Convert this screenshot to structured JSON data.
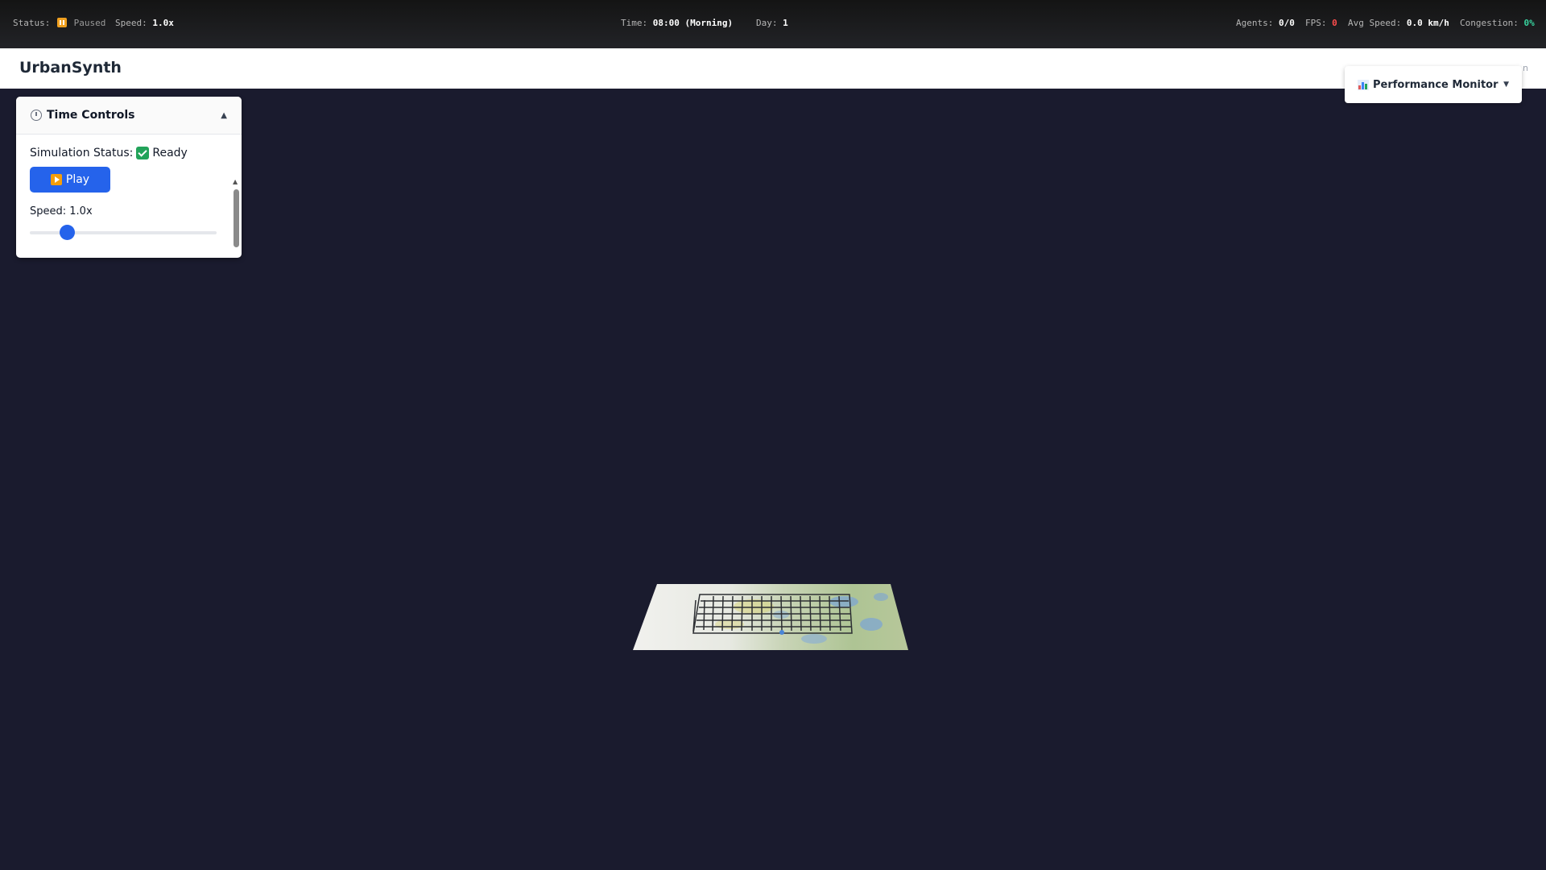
{
  "status_bar": {
    "status_label": "Status:",
    "status_value": "Paused",
    "speed_label": "Speed:",
    "speed_value": "1.0x",
    "time_label": "Time:",
    "time_value": "08:00 (Morning)",
    "day_label": "Day:",
    "day_value": "1",
    "agents_label": "Agents:",
    "agents_value": "0/0",
    "fps_label": "FPS:",
    "fps_value": "0",
    "avg_speed_label": "Avg Speed:",
    "avg_speed_value": "0.0 km/h",
    "congestion_label": "Congestion:",
    "congestion_value": "0%"
  },
  "header": {
    "title": "UrbanSynth",
    "trailing_text": "n"
  },
  "time_controls": {
    "title": "Time Controls",
    "collapse_symbol": "▲",
    "status_label": "Simulation Status:",
    "status_value": "Ready",
    "play_label": "Play",
    "speed_label": "Speed: 1.0x",
    "speed_slider_fraction": 0.2,
    "scroll_up": "▲",
    "scroll_down": "▼"
  },
  "performance_monitor": {
    "label": "Performance Monitor",
    "caret": "▼"
  },
  "icons": {
    "status": "pause-icon",
    "timer": "timer-icon",
    "ready": "check-icon",
    "play": "play-icon",
    "monitor": "bar-chart-icon"
  },
  "colors": {
    "background": "#1a1b2e",
    "accent": "#2563eb",
    "alert": "#ff4d4d",
    "ok": "#38d39f",
    "paused": "#f0a020"
  }
}
